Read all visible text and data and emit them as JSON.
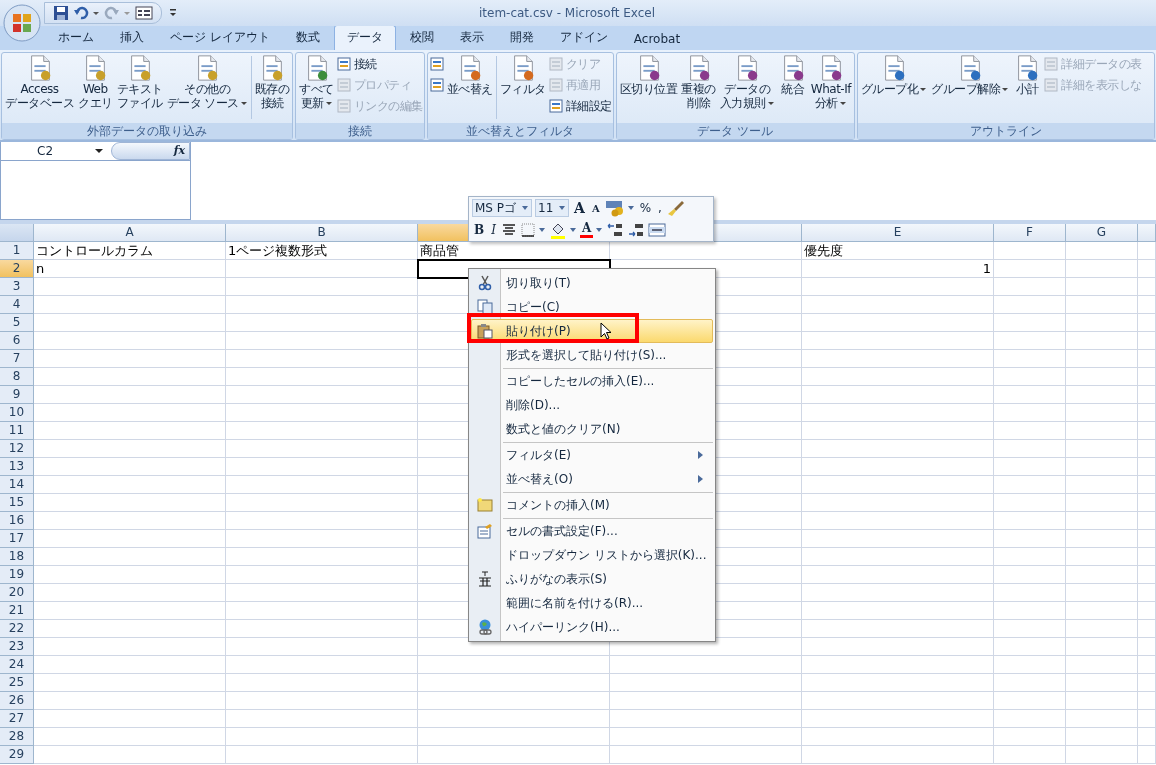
{
  "window": {
    "title": "item-cat.csv - Microsoft Excel"
  },
  "tabs": [
    {
      "label": "ホーム",
      "selected": false
    },
    {
      "label": "挿入",
      "selected": false
    },
    {
      "label": "ページ レイアウト",
      "selected": false
    },
    {
      "label": "数式",
      "selected": false
    },
    {
      "label": "データ",
      "selected": true
    },
    {
      "label": "校閲",
      "selected": false
    },
    {
      "label": "表示",
      "selected": false
    },
    {
      "label": "開発",
      "selected": false
    },
    {
      "label": "アドイン",
      "selected": false
    },
    {
      "label": "Acrobat",
      "selected": false
    }
  ],
  "ribbon_groups": [
    {
      "label": "外部データの取り込み",
      "buttons": [
        {
          "kind": "large",
          "lines": [
            "Access",
            "データベース"
          ],
          "dropdown": false
        },
        {
          "kind": "large",
          "lines": [
            "Web",
            "クエリ"
          ],
          "dropdown": false
        },
        {
          "kind": "large",
          "lines": [
            "テキスト",
            "ファイル"
          ],
          "dropdown": false
        },
        {
          "kind": "large",
          "lines": [
            "その他の",
            "データ ソース"
          ],
          "dropdown": true
        },
        {
          "kind": "separator"
        },
        {
          "kind": "large",
          "lines": [
            "既存の",
            "接続"
          ],
          "dropdown": false
        }
      ]
    },
    {
      "label": "接続",
      "buttons": [
        {
          "kind": "large",
          "lines": [
            "すべて",
            "更新"
          ],
          "dropdown": true
        },
        {
          "kind": "stack",
          "items": [
            {
              "label": "接続",
              "disabled": false
            },
            {
              "label": "プロパティ",
              "disabled": true
            },
            {
              "label": "リンクの編集",
              "disabled": true
            }
          ]
        }
      ]
    },
    {
      "label": "並べ替えとフィルタ",
      "buttons": [
        {
          "kind": "stack",
          "items": [
            {
              "disabled": false
            },
            {
              "disabled": false
            }
          ]
        },
        {
          "kind": "large",
          "lines": [
            "並べ替え"
          ],
          "dropdown": false
        },
        {
          "kind": "separator"
        },
        {
          "kind": "large",
          "lines": [
            "フィルタ"
          ],
          "dropdown": false
        },
        {
          "kind": "stack",
          "items": [
            {
              "label": "クリア",
              "disabled": true
            },
            {
              "label": "再適用",
              "disabled": true
            },
            {
              "label": "詳細設定",
              "disabled": false
            }
          ]
        }
      ]
    },
    {
      "label": "データ ツール",
      "buttons": [
        {
          "kind": "large",
          "lines": [
            "区切り位置"
          ],
          "dropdown": false
        },
        {
          "kind": "large",
          "lines": [
            "重複の",
            "削除"
          ],
          "dropdown": false
        },
        {
          "kind": "large",
          "lines": [
            "データの",
            "入力規則"
          ],
          "dropdown": true
        },
        {
          "kind": "large",
          "lines": [
            "統合"
          ],
          "dropdown": false
        },
        {
          "kind": "large",
          "lines": [
            "What-If",
            "分析"
          ],
          "dropdown": true
        }
      ]
    },
    {
      "label": "アウトライン",
      "buttons": [
        {
          "kind": "large",
          "lines": [
            "グループ化"
          ],
          "dropdown": true
        },
        {
          "kind": "large",
          "lines": [
            "グループ解除"
          ],
          "dropdown": true
        },
        {
          "kind": "large",
          "lines": [
            "小計"
          ],
          "dropdown": false
        },
        {
          "kind": "stack",
          "items": [
            {
              "label": "詳細データの表",
              "disabled": true
            },
            {
              "label": "詳細を表示しな",
              "disabled": true
            }
          ]
        }
      ]
    }
  ],
  "name_box": {
    "value": "C2"
  },
  "formula_bar": {
    "fx": "fx"
  },
  "columns": [
    {
      "label": "A",
      "selected": false
    },
    {
      "label": "B",
      "selected": false
    },
    {
      "selected": true
    },
    {
      "selected": false
    },
    {
      "label": "E",
      "selected": false
    },
    {
      "label": "F",
      "selected": false
    },
    {
      "label": "G",
      "selected": false
    }
  ],
  "rows": [
    {
      "number": "1",
      "selected": false,
      "cells": [
        {
          "text": "コントロールカラム"
        },
        {
          "text": "1ページ複数形式"
        },
        {
          "text": "商品管"
        },
        null,
        {
          "text": "優先度"
        }
      ]
    },
    {
      "number": "2",
      "selected": true,
      "cells": [
        {
          "text": "n"
        },
        null,
        null,
        null,
        {
          "text": "1",
          "kind": "number"
        }
      ]
    },
    {
      "number": "3",
      "selected": false
    },
    {
      "number": "4",
      "selected": false
    },
    {
      "number": "5",
      "selected": false
    },
    {
      "number": "6",
      "selected": false
    },
    {
      "number": "7",
      "selected": false
    },
    {
      "number": "8",
      "selected": false
    },
    {
      "number": "9",
      "selected": false
    },
    {
      "number": "10",
      "selected": false
    },
    {
      "number": "11",
      "selected": false
    },
    {
      "number": "12",
      "selected": false
    },
    {
      "number": "13",
      "selected": false
    },
    {
      "number": "14",
      "selected": false
    },
    {
      "number": "15",
      "selected": false
    },
    {
      "number": "16",
      "selected": false
    },
    {
      "number": "17",
      "selected": false
    },
    {
      "number": "18",
      "selected": false
    },
    {
      "number": "19",
      "selected": false
    },
    {
      "number": "20",
      "selected": false
    },
    {
      "number": "21",
      "selected": false
    },
    {
      "number": "22",
      "selected": false
    },
    {
      "number": "23",
      "selected": false
    },
    {
      "number": "24",
      "selected": false
    },
    {
      "number": "25",
      "selected": false
    },
    {
      "number": "26",
      "selected": false
    },
    {
      "number": "27",
      "selected": false
    },
    {
      "number": "28",
      "selected": false
    },
    {
      "number": "29",
      "selected": false
    }
  ],
  "mini_toolbar": {
    "font": "MS Pゴ",
    "size": "11",
    "row1": [
      {
        "kind": "grow",
        "label": "A"
      },
      {
        "kind": "shrink",
        "label": "A"
      },
      {
        "kind": "currency"
      },
      {
        "kind": "caret"
      },
      {
        "kind": "text",
        "label": "%"
      },
      {
        "kind": "text",
        "label": ","
      },
      {
        "kind": "brush"
      }
    ],
    "row2": [
      {
        "kind": "bold",
        "label": "B"
      },
      {
        "kind": "italic",
        "label": "I"
      },
      {
        "kind": "center"
      },
      {
        "kind": "borders"
      },
      {
        "kind": "caret"
      },
      {
        "kind": "fill"
      },
      {
        "kind": "caret"
      },
      {
        "kind": "font-color",
        "label": "A"
      },
      {
        "kind": "caret"
      },
      {
        "kind": "inc-decimal"
      },
      {
        "kind": "dec-decimal"
      },
      {
        "kind": "merge"
      }
    ]
  },
  "context_menu": [
    {
      "kind": "item",
      "label": "切り取り(T)",
      "selected": false,
      "submenu": false
    },
    {
      "kind": "item",
      "label": "コピー(C)",
      "selected": false,
      "submenu": false
    },
    {
      "kind": "item",
      "label": "貼り付け(P)",
      "selected": true,
      "submenu": false
    },
    {
      "kind": "item",
      "label": "形式を選択して貼り付け(S)...",
      "selected": false,
      "submenu": false
    },
    {
      "kind": "separator"
    },
    {
      "kind": "item",
      "label": "コピーしたセルの挿入(E)...",
      "selected": false,
      "submenu": false
    },
    {
      "kind": "item",
      "label": "削除(D)...",
      "selected": false,
      "submenu": false
    },
    {
      "kind": "item",
      "label": "数式と値のクリア(N)",
      "selected": false,
      "submenu": false
    },
    {
      "kind": "separator"
    },
    {
      "kind": "item",
      "label": "フィルタ(E)",
      "selected": false,
      "submenu": true
    },
    {
      "kind": "item",
      "label": "並べ替え(O)",
      "selected": false,
      "submenu": true
    },
    {
      "kind": "separator"
    },
    {
      "kind": "item",
      "label": "コメントの挿入(M)",
      "selected": false,
      "submenu": false
    },
    {
      "kind": "separator"
    },
    {
      "kind": "item",
      "label": "セルの書式設定(F)...",
      "selected": false,
      "submenu": false
    },
    {
      "kind": "item",
      "label": "ドロップダウン リストから選択(K)...",
      "selected": false,
      "submenu": false
    },
    {
      "kind": "item",
      "label": "ふりがなの表示(S)",
      "selected": false,
      "submenu": false
    },
    {
      "kind": "item",
      "label": "範囲に名前を付ける(R)...",
      "selected": false,
      "submenu": false
    },
    {
      "kind": "item",
      "label": "ハイパーリンク(H)...",
      "selected": false,
      "submenu": false
    }
  ]
}
